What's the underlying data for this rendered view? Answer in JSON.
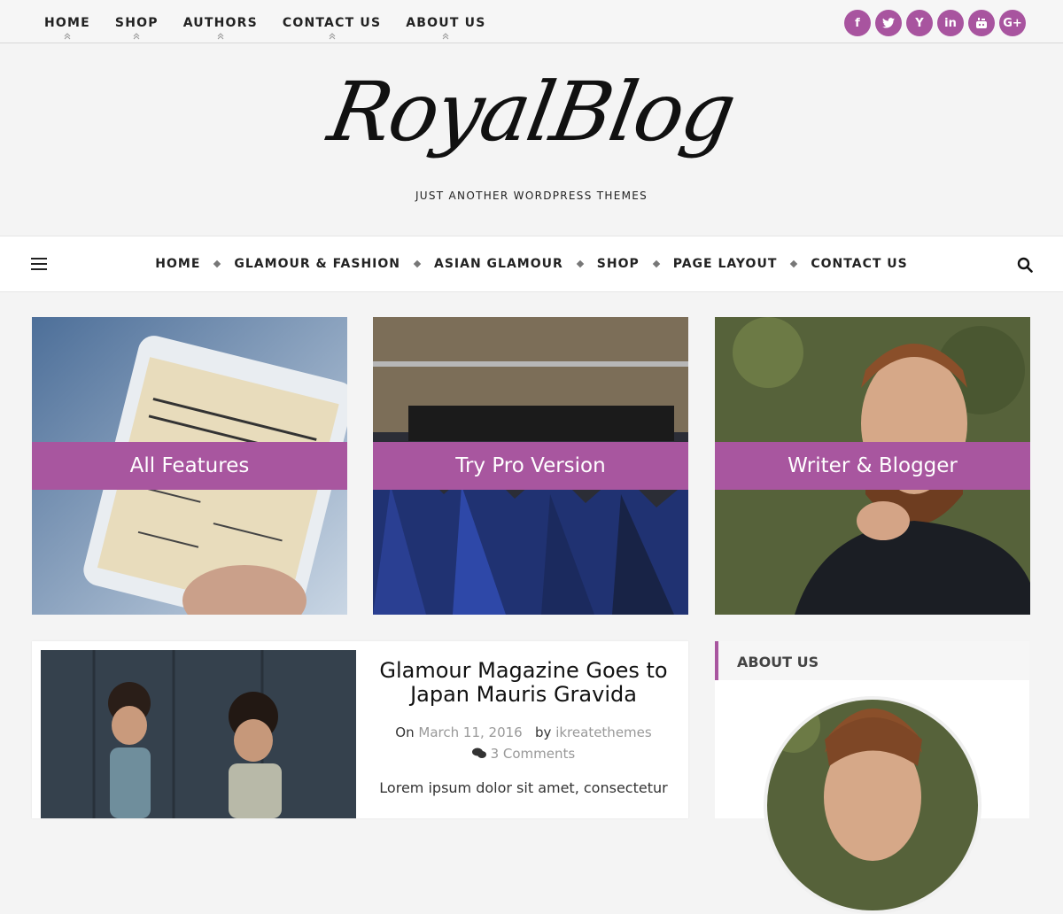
{
  "colors": {
    "accent": "#a8569f",
    "background": "#f4f4f4"
  },
  "top_nav": {
    "items": [
      {
        "label": "HOME"
      },
      {
        "label": "SHOP"
      },
      {
        "label": "AUTHORS"
      },
      {
        "label": "CONTACT US"
      },
      {
        "label": "ABOUT US"
      }
    ]
  },
  "social": {
    "icons": [
      {
        "name": "facebook-icon",
        "glyph": "f"
      },
      {
        "name": "twitter-icon",
        "glyph": "t"
      },
      {
        "name": "yahoo-icon",
        "glyph": "Y"
      },
      {
        "name": "linkedin-icon",
        "glyph": "in"
      },
      {
        "name": "youtube-icon",
        "glyph": "▶"
      },
      {
        "name": "google-plus-icon",
        "glyph": "G+"
      }
    ]
  },
  "logo": {
    "title": "RoyalBlog",
    "tagline": "JUST ANOTHER WORDPRESS THEMES"
  },
  "main_nav": {
    "items": [
      {
        "label": "HOME"
      },
      {
        "label": "GLAMOUR & FASHION"
      },
      {
        "label": "ASIAN GLAMOUR"
      },
      {
        "label": "SHOP"
      },
      {
        "label": "PAGE LAYOUT"
      },
      {
        "label": "CONTACT US"
      }
    ]
  },
  "features": [
    {
      "label": "All Features"
    },
    {
      "label": "Try Pro Version"
    },
    {
      "label": "Writer & Blogger"
    }
  ],
  "post": {
    "title": "Glamour Magazine Goes to Japan Mauris Gravida",
    "on": "On",
    "date": "March 11, 2016",
    "by": "by",
    "author": "ikreatethemes",
    "comments": "3 Comments",
    "excerpt": "Lorem ipsum dolor sit amet, consectetur"
  },
  "sidebar": {
    "about_title": "ABOUT US"
  }
}
